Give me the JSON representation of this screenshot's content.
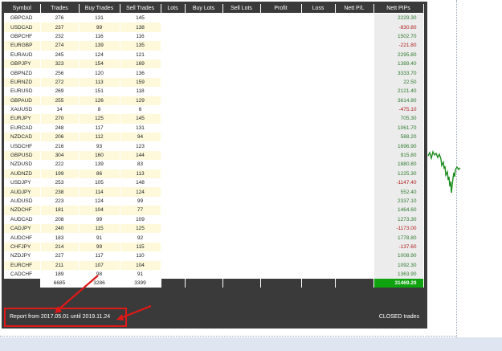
{
  "columns": [
    "Symbol",
    "Trades",
    "Buy Trades",
    "Sell Trades",
    "Lots",
    "Buy Lots",
    "Sell Lots",
    "Profit",
    "Loss",
    "Nett P/L",
    "Nett PIPs"
  ],
  "rows": [
    {
      "symbol": "GBPCAD",
      "trades": "276",
      "buy": "131",
      "sell": "145",
      "pips": "2229.30",
      "sign": "pos"
    },
    {
      "symbol": "USDCAD",
      "trades": "237",
      "buy": "99",
      "sell": "138",
      "pips": "-830.80",
      "sign": "neg"
    },
    {
      "symbol": "GBPCHF",
      "trades": "232",
      "buy": "116",
      "sell": "116",
      "pips": "1502.70",
      "sign": "pos"
    },
    {
      "symbol": "EURGBP",
      "trades": "274",
      "buy": "139",
      "sell": "135",
      "pips": "-221.80",
      "sign": "neg"
    },
    {
      "symbol": "EURAUD",
      "trades": "245",
      "buy": "124",
      "sell": "121",
      "pips": "2295.80",
      "sign": "pos"
    },
    {
      "symbol": "GBPJPY",
      "trades": "323",
      "buy": "154",
      "sell": "169",
      "pips": "1389.40",
      "sign": "pos"
    },
    {
      "symbol": "GBPNZD",
      "trades": "256",
      "buy": "120",
      "sell": "136",
      "pips": "3333.70",
      "sign": "pos"
    },
    {
      "symbol": "EURNZD",
      "trades": "272",
      "buy": "113",
      "sell": "159",
      "pips": "22.50",
      "sign": "pos"
    },
    {
      "symbol": "EURUSD",
      "trades": "269",
      "buy": "151",
      "sell": "118",
      "pips": "2121.40",
      "sign": "pos"
    },
    {
      "symbol": "GBPAUD",
      "trades": "255",
      "buy": "126",
      "sell": "129",
      "pips": "3614.80",
      "sign": "pos"
    },
    {
      "symbol": "XAUUSD",
      "trades": "14",
      "buy": "8",
      "sell": "6",
      "pips": "-475.10",
      "sign": "neg"
    },
    {
      "symbol": "EURJPY",
      "trades": "270",
      "buy": "125",
      "sell": "145",
      "pips": "705.30",
      "sign": "pos"
    },
    {
      "symbol": "EURCAD",
      "trades": "248",
      "buy": "117",
      "sell": "131",
      "pips": "1061.70",
      "sign": "pos"
    },
    {
      "symbol": "NZDCAD",
      "trades": "206",
      "buy": "112",
      "sell": "94",
      "pips": "588.20",
      "sign": "pos"
    },
    {
      "symbol": "USDCHF",
      "trades": "216",
      "buy": "93",
      "sell": "123",
      "pips": "1696.90",
      "sign": "pos"
    },
    {
      "symbol": "GBPUSD",
      "trades": "304",
      "buy": "160",
      "sell": "144",
      "pips": "915.80",
      "sign": "pos"
    },
    {
      "symbol": "NZDUSD",
      "trades": "222",
      "buy": "139",
      "sell": "83",
      "pips": "1880.80",
      "sign": "pos"
    },
    {
      "symbol": "AUDNZD",
      "trades": "199",
      "buy": "86",
      "sell": "113",
      "pips": "1225.30",
      "sign": "pos"
    },
    {
      "symbol": "USDJPY",
      "trades": "253",
      "buy": "105",
      "sell": "148",
      "pips": "-1147.40",
      "sign": "neg"
    },
    {
      "symbol": "AUDJPY",
      "trades": "238",
      "buy": "114",
      "sell": "124",
      "pips": "552.40",
      "sign": "pos"
    },
    {
      "symbol": "AUDUSD",
      "trades": "223",
      "buy": "124",
      "sell": "99",
      "pips": "2337.10",
      "sign": "pos"
    },
    {
      "symbol": "NZDCHF",
      "trades": "181",
      "buy": "104",
      "sell": "77",
      "pips": "1464.60",
      "sign": "pos"
    },
    {
      "symbol": "AUDCAD",
      "trades": "208",
      "buy": "99",
      "sell": "109",
      "pips": "1273.30",
      "sign": "pos"
    },
    {
      "symbol": "CADJPY",
      "trades": "240",
      "buy": "115",
      "sell": "125",
      "pips": "-1173.00",
      "sign": "neg"
    },
    {
      "symbol": "AUDCHF",
      "trades": "183",
      "buy": "91",
      "sell": "92",
      "pips": "1778.80",
      "sign": "pos"
    },
    {
      "symbol": "CHFJPY",
      "trades": "214",
      "buy": "99",
      "sell": "115",
      "pips": "-137.60",
      "sign": "neg"
    },
    {
      "symbol": "NZDJPY",
      "trades": "227",
      "buy": "117",
      "sell": "110",
      "pips": "1008.90",
      "sign": "pos"
    },
    {
      "symbol": "EURCHF",
      "trades": "211",
      "buy": "107",
      "sell": "104",
      "pips": "1092.30",
      "sign": "pos"
    },
    {
      "symbol": "CADCHF",
      "trades": "189",
      "buy": "98",
      "sell": "91",
      "pips": "1363.90",
      "sign": "pos"
    }
  ],
  "totals": {
    "trades": "6685",
    "buy": "3286",
    "sell": "3399",
    "pips": "31469.20"
  },
  "footer": {
    "range": "Report from 2017.05.01 until 2019.11.24",
    "status": "CLOSED trades"
  },
  "colors": {
    "panel": "#3a3a3a",
    "alt_row": "#fdf9da",
    "positive": "#2d7a2d",
    "negative": "#b02020",
    "total_pips_bg": "#0fa30f",
    "annotation": "#e01818",
    "price_line": "#1e8c1e"
  }
}
